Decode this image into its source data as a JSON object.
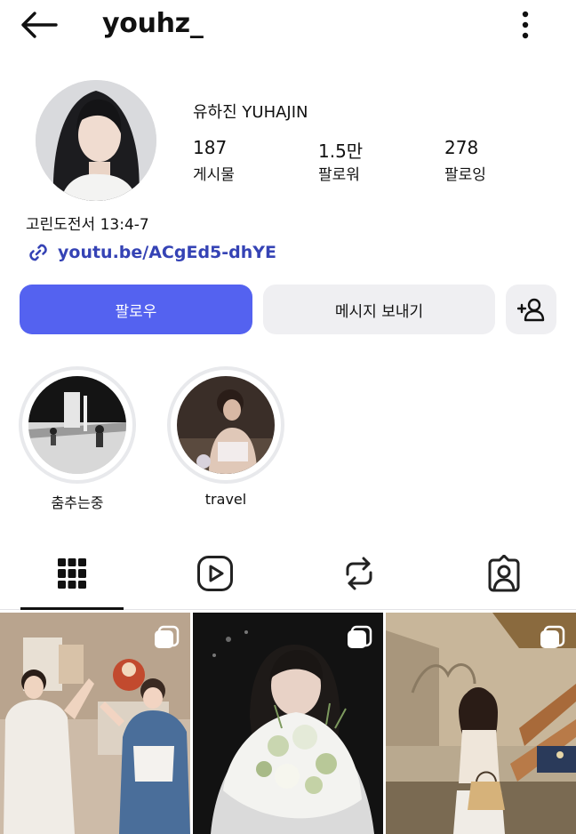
{
  "header": {
    "username": "youhz_",
    "back_icon": "arrow-left-icon",
    "more_icon": "more-vertical-icon"
  },
  "profile": {
    "display_name": "유하진 YUHAJIN",
    "stats": [
      {
        "value": "187",
        "label": "게시물"
      },
      {
        "value": "1.5만",
        "label": "팔로워"
      },
      {
        "value": "278",
        "label": "팔로잉"
      }
    ],
    "bio": "고린도전서 13:4-7",
    "link": "youtu.be/ACgEd5-dhYE"
  },
  "actions": {
    "follow_label": "팔로우",
    "message_label": "메시지 보내기",
    "add_user_icon": "add-user-icon"
  },
  "highlights": [
    {
      "label": "춤추는중"
    },
    {
      "label": "travel"
    }
  ],
  "tabs": [
    {
      "name": "posts",
      "icon": "grid-icon",
      "active": true
    },
    {
      "name": "reels",
      "icon": "reels-icon",
      "active": false
    },
    {
      "name": "reposts",
      "icon": "repost-icon",
      "active": false
    },
    {
      "name": "tagged",
      "icon": "tagged-icon",
      "active": false
    }
  ],
  "colors": {
    "accent": "#5462f0",
    "link": "#3543b5",
    "secondary_button": "#efeff2"
  }
}
